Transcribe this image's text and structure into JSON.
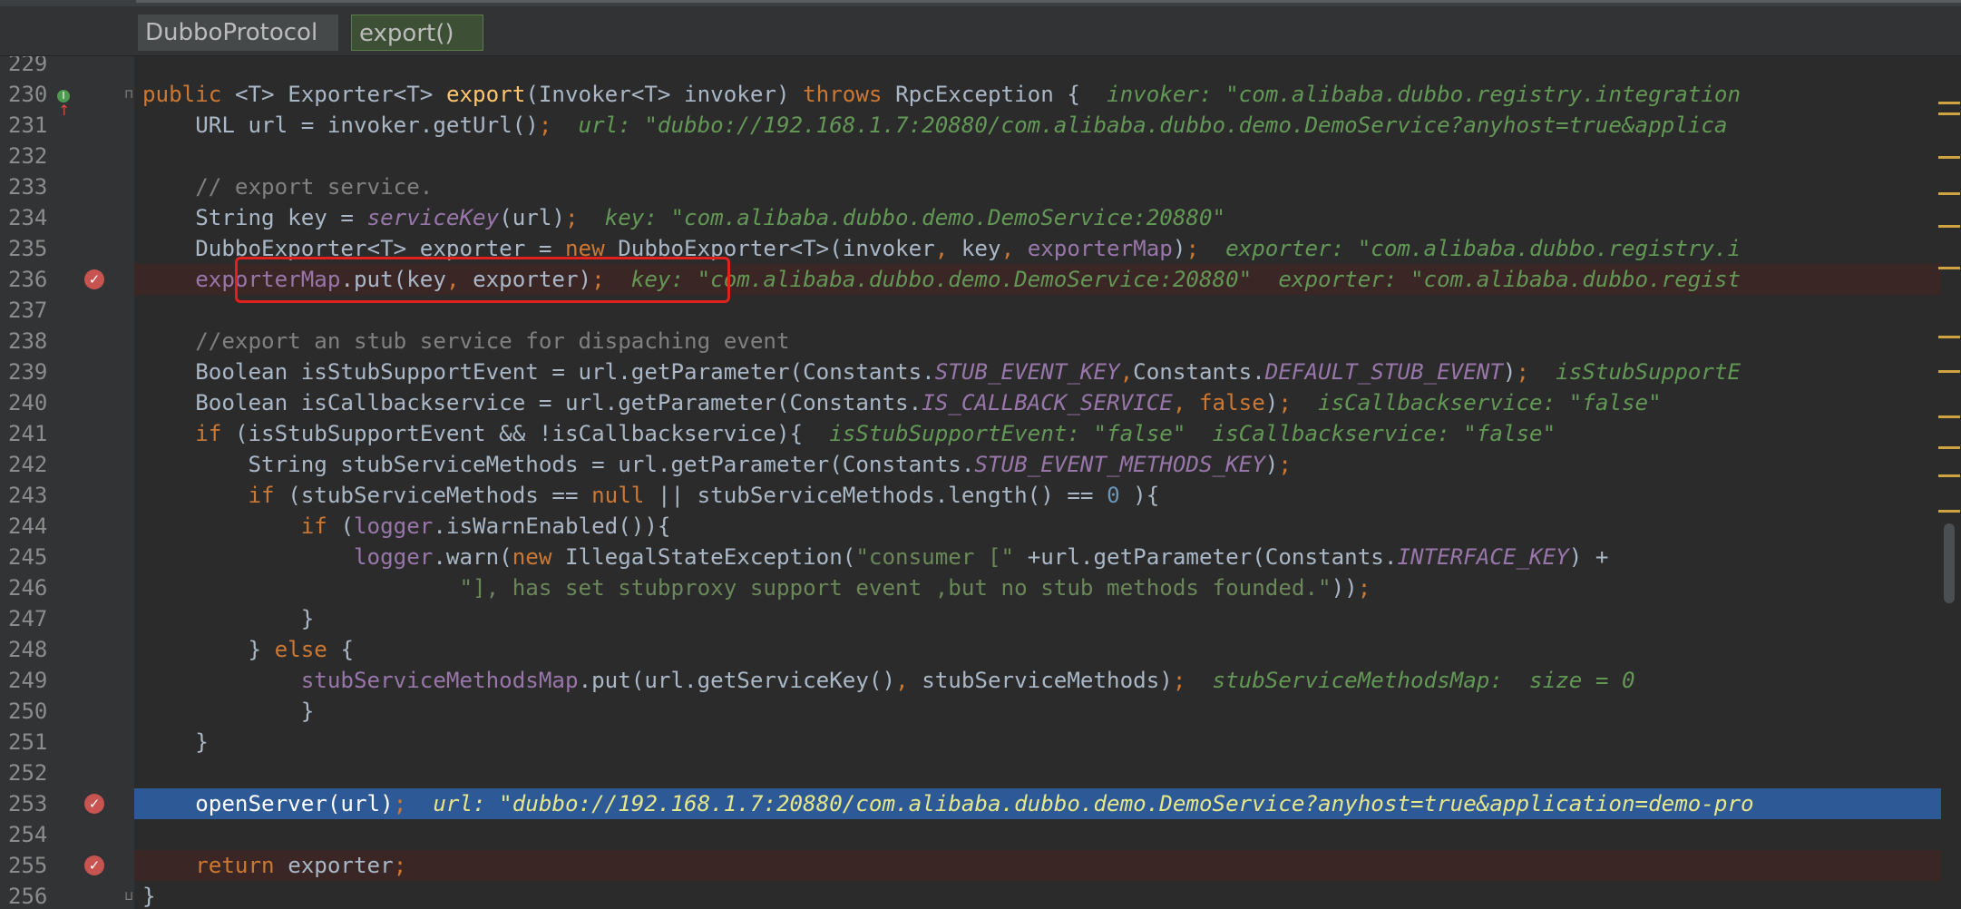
{
  "breadcrumb": {
    "class_name": "DubboProtocol",
    "method_name": "export()"
  },
  "lines": [
    {
      "num": "229",
      "segments": []
    },
    {
      "num": "230",
      "segments": [
        {
          "t": "public ",
          "c": "kw"
        },
        {
          "t": "<T> ",
          "c": "tp"
        },
        {
          "t": "Exporter<T> ",
          "c": ""
        },
        {
          "t": "export",
          "c": "fn"
        },
        {
          "t": "(Invoker<T> invoker) ",
          "c": ""
        },
        {
          "t": "throws ",
          "c": "kw"
        },
        {
          "t": "RpcException {  ",
          "c": ""
        },
        {
          "t": "invoker: \"com.alibaba.dubbo.registry.integration",
          "c": "hint"
        }
      ]
    },
    {
      "num": "231",
      "segments": [
        {
          "t": "    URL url = invoker.getUrl()",
          "c": ""
        },
        {
          "t": ";",
          "c": "kw"
        },
        {
          "t": "  url: \"dubbo://192.168.1.7:20880/com.alibaba.dubbo.demo.DemoService?anyhost=true&applica",
          "c": "hint"
        }
      ]
    },
    {
      "num": "232",
      "segments": []
    },
    {
      "num": "233",
      "segments": [
        {
          "t": "    // export service.",
          "c": "cmt"
        }
      ]
    },
    {
      "num": "234",
      "segments": [
        {
          "t": "    String key = ",
          "c": ""
        },
        {
          "t": "serviceKey",
          "c": "cst"
        },
        {
          "t": "(url)",
          "c": ""
        },
        {
          "t": ";",
          "c": "kw"
        },
        {
          "t": "  key: \"com.alibaba.dubbo.demo.DemoService:20880\"",
          "c": "hint"
        }
      ]
    },
    {
      "num": "235",
      "segments": [
        {
          "t": "    DubboExporter<T> exporter = ",
          "c": ""
        },
        {
          "t": "new ",
          "c": "kw"
        },
        {
          "t": "DubboExporter<T>(invoker",
          "c": ""
        },
        {
          "t": ", ",
          "c": "kw"
        },
        {
          "t": "key",
          "c": ""
        },
        {
          "t": ", ",
          "c": "kw"
        },
        {
          "t": "exporterMap",
          "c": "fld"
        },
        {
          "t": ")",
          "c": ""
        },
        {
          "t": ";",
          "c": "kw"
        },
        {
          "t": "  exporter: \"com.alibaba.dubbo.registry.i",
          "c": "hint"
        }
      ]
    },
    {
      "num": "236",
      "segments": [
        {
          "t": "    ",
          "c": ""
        },
        {
          "t": "exporterMap",
          "c": "fld"
        },
        {
          "t": ".put(key",
          "c": ""
        },
        {
          "t": ", ",
          "c": "kw"
        },
        {
          "t": "exporter)",
          "c": ""
        },
        {
          "t": ";",
          "c": "kw"
        },
        {
          "t": "  key: \"com.alibaba.dubbo.demo.DemoService:20880\"  exporter: \"com.alibaba.dubbo.regist",
          "c": "hint"
        }
      ]
    },
    {
      "num": "237",
      "segments": []
    },
    {
      "num": "238",
      "segments": [
        {
          "t": "    //export an stub service for dispaching event",
          "c": "cmt"
        }
      ]
    },
    {
      "num": "239",
      "segments": [
        {
          "t": "    Boolean isStubSupportEvent = url.getParameter(Constants.",
          "c": ""
        },
        {
          "t": "STUB_EVENT_KEY",
          "c": "cst"
        },
        {
          "t": ",",
          "c": "kw"
        },
        {
          "t": "Constants.",
          "c": ""
        },
        {
          "t": "DEFAULT_STUB_EVENT",
          "c": "cst"
        },
        {
          "t": ")",
          "c": ""
        },
        {
          "t": ";",
          "c": "kw"
        },
        {
          "t": "  isStubSupportE",
          "c": "hint"
        }
      ]
    },
    {
      "num": "240",
      "segments": [
        {
          "t": "    Boolean isCallbackservice = url.getParameter(Constants.",
          "c": ""
        },
        {
          "t": "IS_CALLBACK_SERVICE",
          "c": "cst"
        },
        {
          "t": ", ",
          "c": "kw"
        },
        {
          "t": "false",
          "c": "kw"
        },
        {
          "t": ")",
          "c": ""
        },
        {
          "t": ";",
          "c": "kw"
        },
        {
          "t": "  isCallbackservice: \"false\"",
          "c": "hint"
        }
      ]
    },
    {
      "num": "241",
      "segments": [
        {
          "t": "    ",
          "c": ""
        },
        {
          "t": "if ",
          "c": "kw"
        },
        {
          "t": "(isStubSupportEvent && !isCallbackservice){",
          "c": ""
        },
        {
          "t": "  isStubSupportEvent: \"false\"  isCallbackservice: \"false\"",
          "c": "hint"
        }
      ]
    },
    {
      "num": "242",
      "segments": [
        {
          "t": "        String stubServiceMethods = url.getParameter(Constants.",
          "c": ""
        },
        {
          "t": "STUB_EVENT_METHODS_KEY",
          "c": "cst"
        },
        {
          "t": ")",
          "c": ""
        },
        {
          "t": ";",
          "c": "kw"
        }
      ]
    },
    {
      "num": "243",
      "segments": [
        {
          "t": "        ",
          "c": ""
        },
        {
          "t": "if ",
          "c": "kw"
        },
        {
          "t": "(stubServiceMethods == ",
          "c": ""
        },
        {
          "t": "null ",
          "c": "kw"
        },
        {
          "t": "|| stubServiceMethods.length() == ",
          "c": ""
        },
        {
          "t": "0",
          "c": "num"
        },
        {
          "t": " ){",
          "c": ""
        }
      ]
    },
    {
      "num": "244",
      "segments": [
        {
          "t": "            ",
          "c": ""
        },
        {
          "t": "if ",
          "c": "kw"
        },
        {
          "t": "(",
          "c": ""
        },
        {
          "t": "logger",
          "c": "fld"
        },
        {
          "t": ".isWarnEnabled()){",
          "c": ""
        }
      ]
    },
    {
      "num": "245",
      "segments": [
        {
          "t": "                ",
          "c": ""
        },
        {
          "t": "logger",
          "c": "fld"
        },
        {
          "t": ".warn(",
          "c": ""
        },
        {
          "t": "new ",
          "c": "kw"
        },
        {
          "t": "IllegalStateException(",
          "c": ""
        },
        {
          "t": "\"consumer [\" ",
          "c": "str"
        },
        {
          "t": "+url.getParameter(Constants.",
          "c": ""
        },
        {
          "t": "INTERFACE_KEY",
          "c": "cst"
        },
        {
          "t": ") +",
          "c": ""
        }
      ]
    },
    {
      "num": "246",
      "segments": [
        {
          "t": "                        ",
          "c": ""
        },
        {
          "t": "\"], has set stubproxy support event ,but no stub methods founded.\"",
          "c": "str"
        },
        {
          "t": "))",
          "c": ""
        },
        {
          "t": ";",
          "c": "kw"
        }
      ]
    },
    {
      "num": "247",
      "segments": [
        {
          "t": "            }",
          "c": ""
        }
      ]
    },
    {
      "num": "248",
      "segments": [
        {
          "t": "        } ",
          "c": ""
        },
        {
          "t": "else ",
          "c": "kw"
        },
        {
          "t": "{",
          "c": ""
        }
      ]
    },
    {
      "num": "249",
      "segments": [
        {
          "t": "            ",
          "c": ""
        },
        {
          "t": "stubServiceMethodsMap",
          "c": "fld"
        },
        {
          "t": ".put(url.getServiceKey()",
          "c": ""
        },
        {
          "t": ", ",
          "c": "kw"
        },
        {
          "t": "stubServiceMethods)",
          "c": ""
        },
        {
          "t": ";",
          "c": "kw"
        },
        {
          "t": "  stubServiceMethodsMap:  size = 0",
          "c": "hint"
        }
      ]
    },
    {
      "num": "250",
      "segments": [
        {
          "t": "            }",
          "c": ""
        }
      ]
    },
    {
      "num": "251",
      "segments": [
        {
          "t": "    }",
          "c": ""
        }
      ]
    },
    {
      "num": "252",
      "segments": []
    },
    {
      "num": "253",
      "segments": [
        {
          "t": "    openServer(url)",
          "c": ""
        },
        {
          "t": ";",
          "c": "kw"
        },
        {
          "t": "  url: \"dubbo://192.168.1.7:20880/com.alibaba.dubbo.demo.DemoService?anyhost=true&application=demo-pro",
          "c": "hint"
        }
      ]
    },
    {
      "num": "254",
      "segments": []
    },
    {
      "num": "255",
      "segments": [
        {
          "t": "    ",
          "c": ""
        },
        {
          "t": "return ",
          "c": "kw"
        },
        {
          "t": "exporter",
          "c": ""
        },
        {
          "t": ";",
          "c": "kw"
        }
      ]
    },
    {
      "num": "256",
      "segments": [
        {
          "t": "}",
          "c": ""
        }
      ]
    }
  ],
  "breakpoint_lines": [
    "236",
    "253",
    "255"
  ],
  "execution_line": "253",
  "highlighted_line": "236",
  "colors": {
    "keyword": "#cc7832",
    "method": "#ffc66d",
    "field": "#9876aa",
    "string": "#6a8759",
    "comment": "#808080",
    "hint": "#629755",
    "execution_bg": "#2d5a96",
    "breakpoint_bg": "#3b2626",
    "highlight_box": "#e0211d"
  },
  "icons": {
    "breakpoint": "breakpoint-check-icon",
    "implements": "implements-method-icon",
    "fold": "fold-marker-icon"
  }
}
